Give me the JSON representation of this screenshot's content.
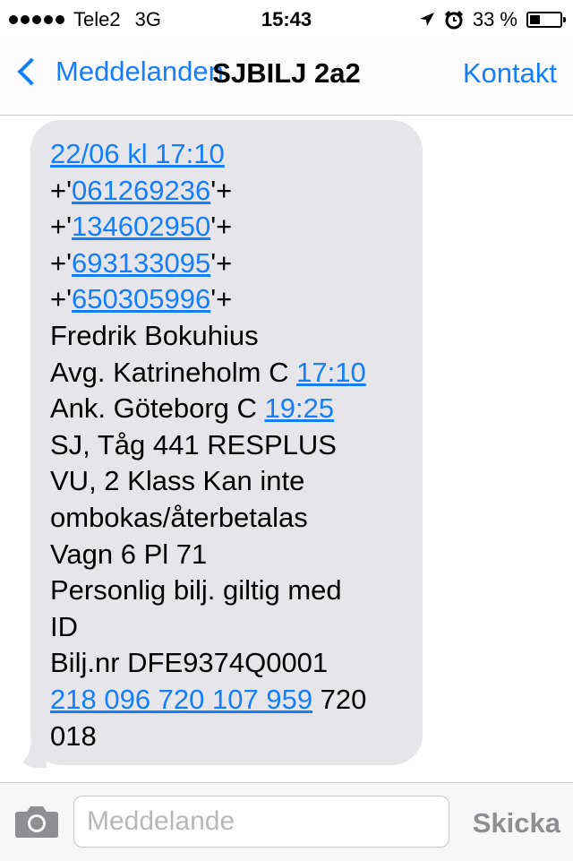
{
  "status_bar": {
    "carrier": "Tele2",
    "network": "3G",
    "time": "15:43",
    "battery_text": "33 %",
    "battery_level": 0.33,
    "icons": [
      "signal-dots-icon",
      "location-arrow-icon",
      "alarm-clock-icon",
      "battery-icon"
    ]
  },
  "nav": {
    "back_label": "Meddelanden",
    "title": "SJBILJ 2a2",
    "contact_label": "Kontakt"
  },
  "message": {
    "lines": [
      [
        {
          "text": "22/06 kl 17:10",
          "link": true
        }
      ],
      [
        {
          "text": "+'",
          "link": false
        },
        {
          "text": "061269236",
          "link": true
        },
        {
          "text": "'+",
          "link": false
        }
      ],
      [
        {
          "text": "+'",
          "link": false
        },
        {
          "text": "134602950",
          "link": true
        },
        {
          "text": "'+",
          "link": false
        }
      ],
      [
        {
          "text": "+'",
          "link": false
        },
        {
          "text": "693133095",
          "link": true
        },
        {
          "text": "'+",
          "link": false
        }
      ],
      [
        {
          "text": "+'",
          "link": false
        },
        {
          "text": "650305996",
          "link": true
        },
        {
          "text": "'+",
          "link": false
        }
      ],
      [
        {
          "text": "Fredrik Bokuhius",
          "link": false
        }
      ],
      [
        {
          "text": "Avg. Katrineholm C ",
          "link": false
        },
        {
          "text": "17:10",
          "link": true
        }
      ],
      [
        {
          "text": "Ank. Göteborg C ",
          "link": false
        },
        {
          "text": "19:25",
          "link": true
        }
      ],
      [
        {
          "text": "SJ, Tåg 441 RESPLUS",
          "link": false
        }
      ],
      [
        {
          "text": "VU, 2 Klass Kan inte",
          "link": false
        }
      ],
      [
        {
          "text": "ombokas/återbetalas",
          "link": false
        }
      ],
      [
        {
          "text": "Vagn 6 Pl 71",
          "link": false
        }
      ],
      [
        {
          "text": "Personlig bilj. giltig med",
          "link": false
        }
      ],
      [
        {
          "text": "ID",
          "link": false
        }
      ],
      [
        {
          "text": "Bilj.nr DFE9374Q0001",
          "link": false
        }
      ],
      [
        {
          "text": "218 096 720 107 959",
          "link": true
        },
        {
          "text": " 720",
          "link": false
        }
      ],
      [
        {
          "text": "018",
          "link": false
        }
      ]
    ]
  },
  "input_bar": {
    "placeholder": "Meddelande",
    "value": "",
    "send_label": "Skicka"
  },
  "colors": {
    "accent": "#157efb",
    "bubble": "#e5e5ea",
    "send_disabled": "#8e8e93"
  }
}
